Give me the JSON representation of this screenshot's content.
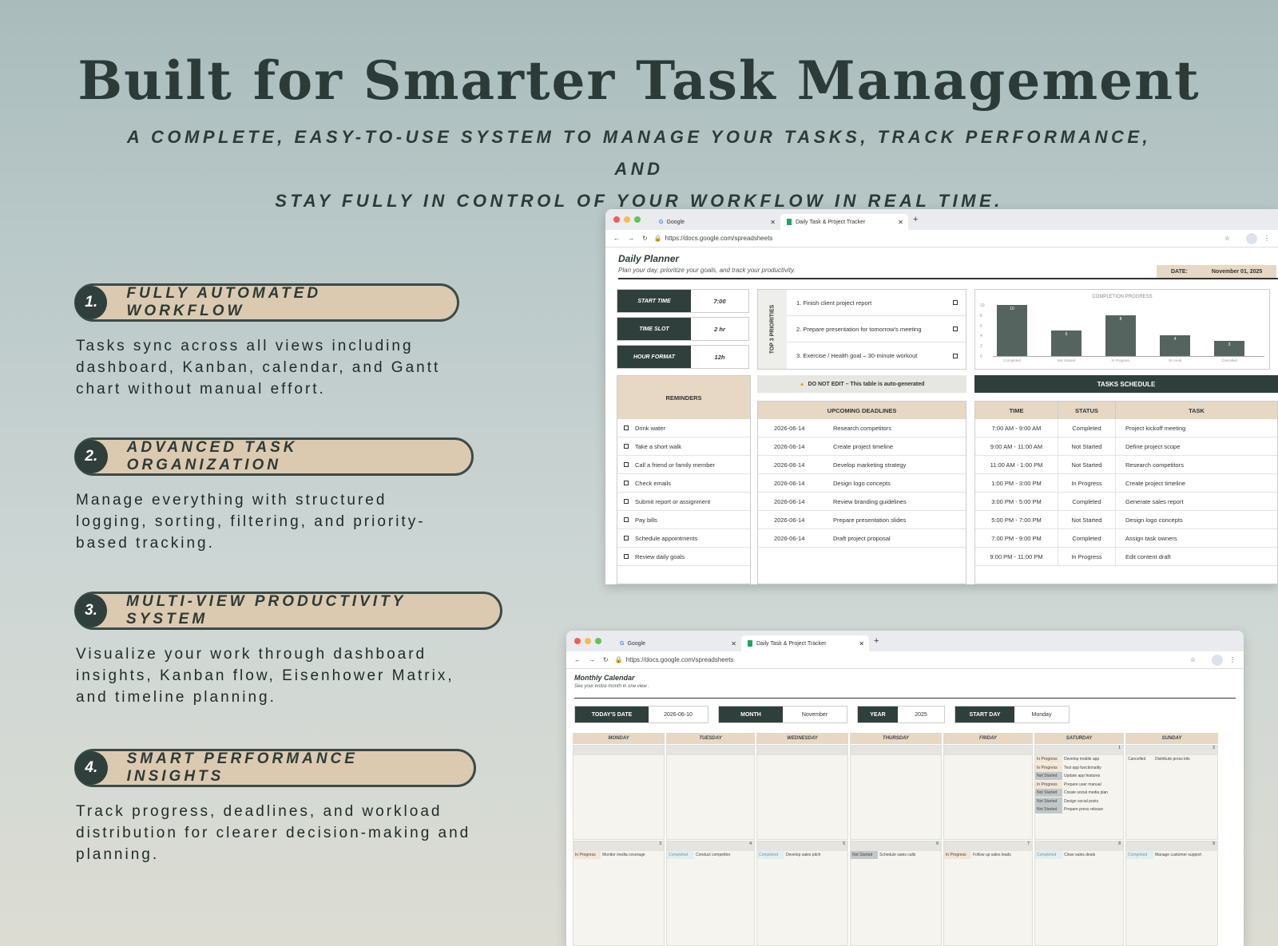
{
  "title": "Built for Smarter Task Management",
  "subtitle_line1": "A COMPLETE, EASY-TO-USE SYSTEM TO MANAGE YOUR TASKS, TRACK PERFORMANCE, AND",
  "subtitle_line2": "STAY FULLY IN CONTROL OF YOUR WORKFLOW IN REAL TIME.",
  "features": [
    {
      "num": "1.",
      "label": "FULLY AUTOMATED WORKFLOW",
      "desc": "Tasks sync across all views including dashboard, Kanban, calendar, and Gantt chart without manual effort."
    },
    {
      "num": "2.",
      "label": "ADVANCED TASK ORGANIZATION",
      "desc": "Manage everything with structured logging, sorting, filtering, and priority-based tracking."
    },
    {
      "num": "3.",
      "label": "MULTI-VIEW PRODUCTIVITY SYSTEM",
      "desc": "Visualize your work through dashboard insights, Kanban flow, Eisenhower Matrix, and timeline planning."
    },
    {
      "num": "4.",
      "label": "SMART PERFORMANCE INSIGHTS",
      "desc": "Track progress, deadlines, and workload distribution for clearer decision-making and planning."
    }
  ],
  "browser": {
    "tab1": "Google",
    "tab2": "Daily Task & Project Tracker",
    "url": "https://docs.google.com/spreadsheets"
  },
  "daily": {
    "title": "Daily Planner",
    "subtitle": "Plan your day, prioritize your goals, and track your productivity.",
    "date_label": "DATE:",
    "date_value": "November 01, 2025",
    "settings": [
      {
        "label": "START TIME",
        "value": "7:00"
      },
      {
        "label": "TIME SLOT",
        "value": "2 hr"
      },
      {
        "label": "HOUR FORMAT",
        "value": "12h"
      }
    ],
    "priorities_label": "TOP 3 PRIORITIES",
    "priorities": [
      "1. Finish client project report",
      "2. Prepare presentation for tomorrow's meeting",
      "3. Exercise / Health goal – 30-minute workout"
    ],
    "chart_title": "COMPLETION PROGRESS",
    "warning": "DO NOT EDIT – This table is auto-generated",
    "schedule_title": "TASKS SCHEDULE",
    "reminders_title": "REMINDERS",
    "reminders": [
      "Drink water",
      "Take a short walk",
      "Call a friend or family member",
      "Check emails",
      "Submit report or assignment",
      "Pay bills",
      "Schedule appointments",
      "Review daily goals"
    ],
    "deadlines_title": "UPCOMING DEADLINES",
    "deadlines": [
      {
        "date": "2026-06-14",
        "task": "Research competitors"
      },
      {
        "date": "2026-06-14",
        "task": "Create project timeline"
      },
      {
        "date": "2026-06-14",
        "task": "Develop marketing strategy"
      },
      {
        "date": "2026-06-14",
        "task": "Design logo concepts"
      },
      {
        "date": "2026-06-14",
        "task": "Review branding guidelines"
      },
      {
        "date": "2026-06-14",
        "task": "Prepare presentation slides"
      },
      {
        "date": "2026-06-14",
        "task": "Draft project proposal"
      }
    ],
    "sched_headers": [
      "TIME",
      "STATUS",
      "TASK"
    ],
    "schedule": [
      {
        "time": "7:00 AM - 9:00 AM",
        "status": "Completed",
        "task": "Project kickoff meeting"
      },
      {
        "time": "9:00 AM - 11:00 AM",
        "status": "Not Started",
        "task": "Define project scope"
      },
      {
        "time": "11:00 AM - 1:00 PM",
        "status": "Not Started",
        "task": "Research competitors"
      },
      {
        "time": "1:00 PM - 3:00 PM",
        "status": "In Progress",
        "task": "Create project timeline"
      },
      {
        "time": "3:00 PM - 5:00 PM",
        "status": "Completed",
        "task": "Generate sales report"
      },
      {
        "time": "5:00 PM - 7:00 PM",
        "status": "Not Started",
        "task": "Design logo concepts"
      },
      {
        "time": "7:00 PM - 9:00 PM",
        "status": "Completed",
        "task": "Assign task owners"
      },
      {
        "time": "9:00 PM - 11:00 PM",
        "status": "In Progress",
        "task": "Edit content draft"
      }
    ]
  },
  "chart_data": {
    "type": "bar",
    "title": "COMPLETION PROGRESS",
    "categories": [
      "Completed",
      "Not Started",
      "In Progress",
      "On Hold",
      "Cancelled"
    ],
    "values": [
      10,
      5,
      8,
      4,
      3
    ],
    "ylim": [
      0,
      10
    ],
    "yticks": [
      "10",
      "8",
      "6",
      "4",
      "2",
      "0"
    ]
  },
  "monthly": {
    "title": "Monthly Calendar",
    "subtitle": "See your entire month in one view .",
    "controls": [
      {
        "label": "TODAY'S DATE",
        "value": "2026-06-10"
      },
      {
        "label": "MONTH",
        "value": "November"
      },
      {
        "label": "YEAR",
        "value": "2025"
      },
      {
        "label": "START DAY",
        "value": "Monday"
      }
    ],
    "days": [
      "MONDAY",
      "TUESDAY",
      "WEDNESDAY",
      "THURSDAY",
      "FRIDAY",
      "SATURDAY",
      "SUNDAY"
    ],
    "week1_dates": [
      "",
      "",
      "",
      "",
      "",
      "1",
      "2"
    ],
    "saturday_items": [
      {
        "status": "In Progress",
        "task": "Develop mobile app"
      },
      {
        "status": "In Progress",
        "task": "Test app functionality"
      },
      {
        "status": "Not Started",
        "task": "Update app features"
      },
      {
        "status": "In Progress",
        "task": "Prepare user manual"
      },
      {
        "status": "Not Started",
        "task": "Create social media plan"
      },
      {
        "status": "Not Started",
        "task": "Design social posts"
      },
      {
        "status": "Not Started",
        "task": "Prepare press release"
      }
    ],
    "sunday_items": [
      {
        "status": "Cancelled",
        "task": "Distribute press kits"
      }
    ],
    "week2_dates": [
      "3",
      "4",
      "5",
      "6",
      "7",
      "8",
      "9"
    ],
    "week2_items": [
      {
        "status": "In Progress",
        "task": "Monitor media coverage"
      },
      {
        "status": "Completed",
        "task": "Conduct competitor"
      },
      {
        "status": "Completed",
        "task": "Develop sales pitch"
      },
      {
        "status": "Not Started",
        "task": "Schedule sales calls"
      },
      {
        "status": "In Progress",
        "task": "Follow up sales leads"
      },
      {
        "status": "Completed",
        "task": "Close sales deals"
      },
      {
        "status": "Completed",
        "task": "Manage customer support"
      }
    ]
  }
}
